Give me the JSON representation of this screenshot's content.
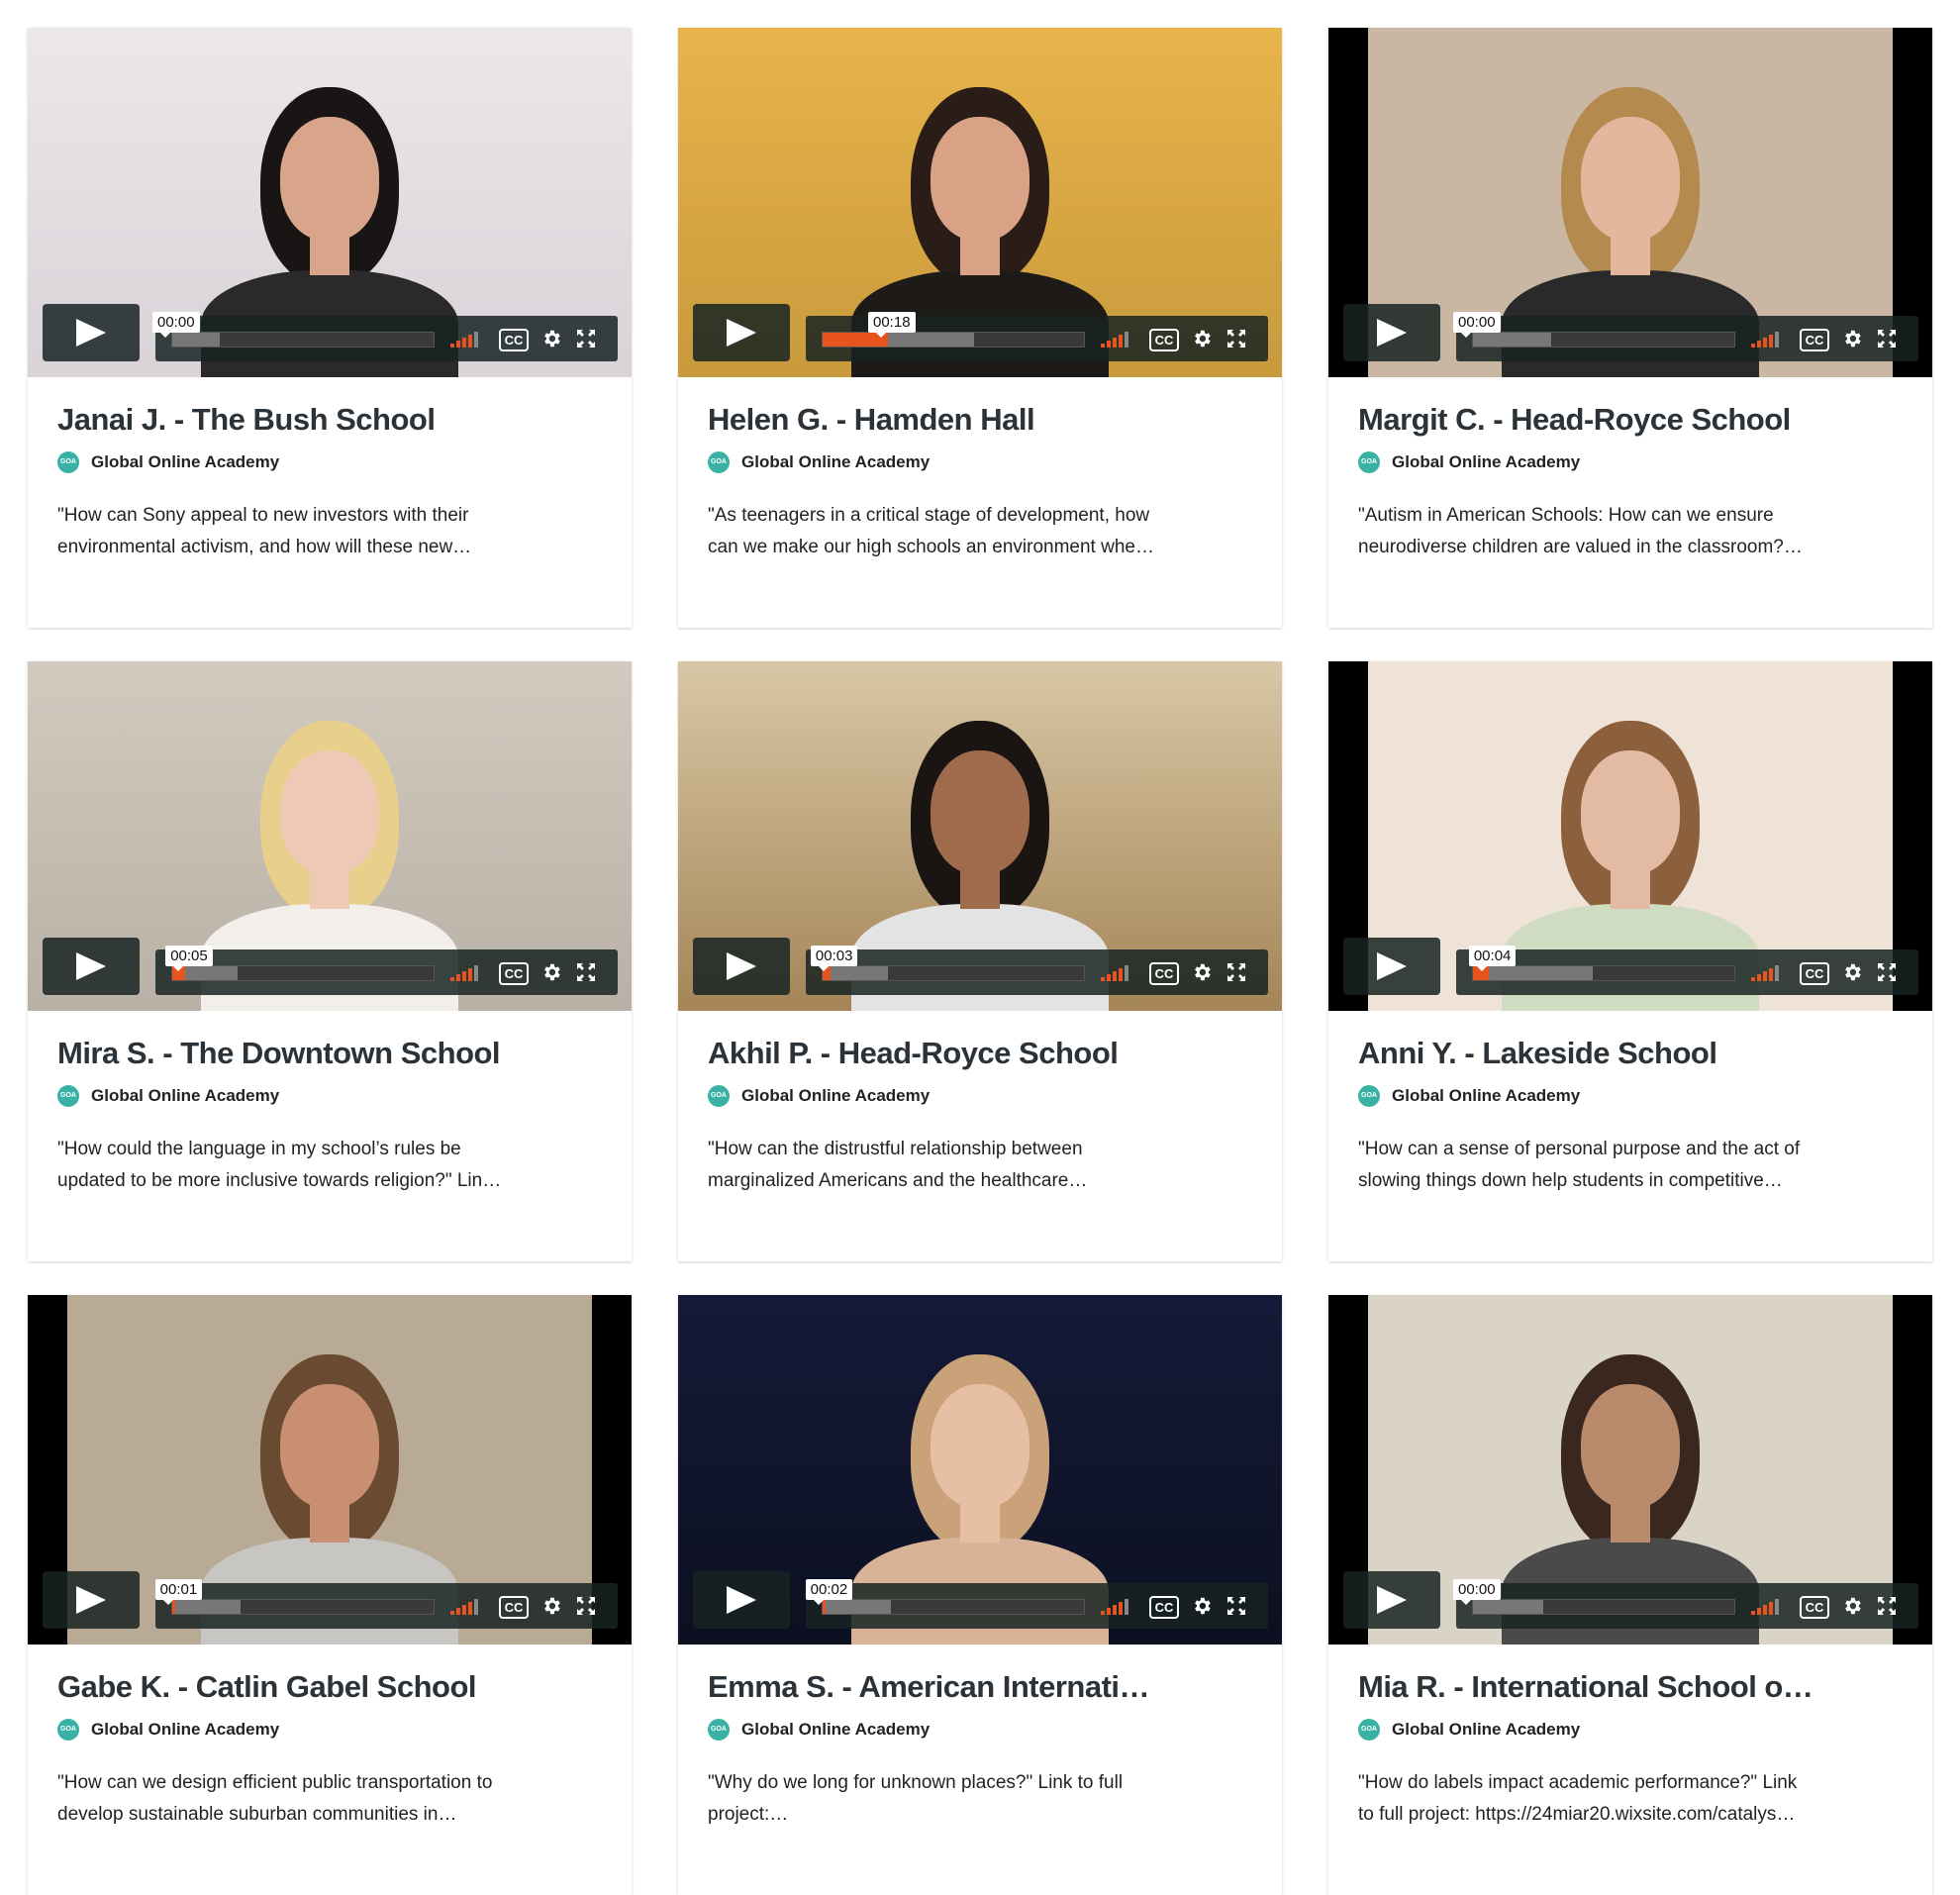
{
  "org_name": "Global Online Academy",
  "org_logo_text": "GOA",
  "cc_label": "CC",
  "cards": [
    {
      "title": "Janai J. - The Bush School",
      "time": "00:00",
      "progress": 0.0,
      "buffered": 0.18,
      "desc_1": "\"How can Sony appeal to new investors with their",
      "desc_2": "environmental activism, and how will these new…",
      "scene": {
        "bg": "#d9d3d8",
        "wall": "#ebe7ea",
        "skin": "#d9a58a",
        "hair": "#1a1515",
        "shirt": "#2a2a2a"
      }
    },
    {
      "title": "Helen G. - Hamden Hall",
      "time": "00:18",
      "progress": 0.25,
      "buffered": 0.58,
      "desc_1": "\"As teenagers in a critical stage of development, how",
      "desc_2": "can we make our high schools an environment whe…",
      "scene": {
        "bg": "#c89a3c",
        "wall": "#e8b44a",
        "skin": "#d9a286",
        "hair": "#2a1d18",
        "shirt": "#1e1a18"
      }
    },
    {
      "title": "Margit C. - Head-Royce School",
      "time": "00:00",
      "progress": 0.0,
      "buffered": 0.3,
      "desc_1": "\"Autism in American Schools: How can we ensure",
      "desc_2": "neurodiverse children are valued in the classroom?…",
      "scene": {
        "bg": "#000000",
        "wall": "#c9b7a3",
        "skin": "#e3b79e",
        "hair": "#b48a4e",
        "shirt": "#2a2a2a"
      }
    },
    {
      "title": "Mira S. - The Downtown School",
      "time": "00:05",
      "progress": 0.05,
      "buffered": 0.25,
      "desc_1": "\"How could the language in my school’s rules be",
      "desc_2": "updated to be more inclusive towards religion?\" Lin…",
      "scene": {
        "bg": "#b9b1a6",
        "wall": "#d2cabf",
        "skin": "#f0c9b6",
        "hair": "#e8d08c",
        "shirt": "#f2efea"
      }
    },
    {
      "title": "Akhil P. - Head-Royce School",
      "time": "00:03",
      "progress": 0.03,
      "buffered": 0.25,
      "desc_1": "\"How can the distrustful relationship between",
      "desc_2": "marginalized Americans and the healthcare…",
      "scene": {
        "bg": "#a58557",
        "wall": "#d8c7a6",
        "skin": "#a06b4c",
        "hair": "#1a1512",
        "shirt": "#e3e3e3"
      }
    },
    {
      "title": "Anni Y. - Lakeside School",
      "time": "00:04",
      "progress": 0.06,
      "buffered": 0.46,
      "desc_1": "\"How can a sense of personal purpose and the act of",
      "desc_2": "slowing things down help students in competitive…",
      "scene": {
        "bg": "#000000",
        "wall": "#efe2d6",
        "skin": "#e3bba3",
        "hair": "#8c5f3d",
        "shirt": "#cfdcc1"
      }
    },
    {
      "title": "Gabe K. - Catlin Gabel School",
      "time": "00:01",
      "progress": 0.01,
      "buffered": 0.26,
      "desc_1": "\"How can we design efficient public transportation to",
      "desc_2": "develop sustainable suburban communities in…",
      "scene": {
        "bg": "#000000",
        "wall": "#b8aa95",
        "skin": "#c98f72",
        "hair": "#6b4a32",
        "shirt": "#c8c6c2"
      }
    },
    {
      "title": "Emma S. - American Internati…",
      "time": "00:02",
      "progress": 0.01,
      "buffered": 0.26,
      "desc_1": "\"Why do we long for unknown places?\" Link to full",
      "desc_2": "project:…",
      "scene": {
        "bg": "#0d1021",
        "wall": "#141a38",
        "skin": "#e6bfa5",
        "hair": "#c9a27a",
        "shirt": "#d9b398"
      }
    },
    {
      "title": "Mia R. - International School o…",
      "time": "00:00",
      "progress": 0.0,
      "buffered": 0.27,
      "desc_1": "\"How do labels impact academic performance?\" Link",
      "desc_2": "to full project: https://24miar20.wixsite.com/catalys…",
      "scene": {
        "bg": "#000000",
        "wall": "#d9d4c6",
        "skin": "#b98a6c",
        "hair": "#3a2720",
        "shirt": "#4a4a4a"
      }
    }
  ]
}
